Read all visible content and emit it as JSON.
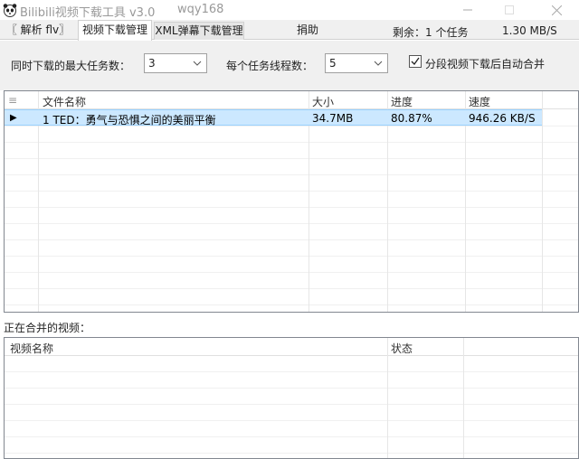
{
  "window": {
    "title": "Bilibili视频下载工具 v3.0",
    "author": "wqy168",
    "icon": "panda-icon",
    "controls": [
      "minimize-icon",
      "maximize-icon",
      "close-icon"
    ]
  },
  "tabs": [
    {
      "label": "〖 解析 flv〗",
      "active": false
    },
    {
      "label": "视频下载管理",
      "active": true
    },
    {
      "label": "XML弹幕下载管理",
      "active": false
    },
    {
      "label": "捐助",
      "active": false
    }
  ],
  "status": {
    "remaining": "剩余：1 个任务",
    "speed": "1.30 MB/S"
  },
  "settings": {
    "max_tasks_label": "同时下载的最大任务数：",
    "max_tasks_value": "3",
    "threads_label": "每个任务线程数：",
    "threads_value": "5",
    "auto_merge_label": "分段视频下载后自动合并",
    "auto_merge_checked": true
  },
  "download_table": {
    "columns": [
      "≡",
      "文件名称",
      "大小",
      "进度",
      "速度"
    ],
    "rows": [
      {
        "marker": "▶",
        "name": "1 TED：勇气与恐惧之间的美丽平衡",
        "size": "34.7MB",
        "progress": "80.87%",
        "speed": "946.26 KB/S",
        "selected": true
      }
    ]
  },
  "merge_section": {
    "label": "正在合并的视频：",
    "columns": [
      "视频名称",
      "状态"
    ],
    "rows": []
  },
  "colors": {
    "selection": "#cce8ff",
    "tabbar": "#f0f0f0",
    "border": "#828790"
  }
}
